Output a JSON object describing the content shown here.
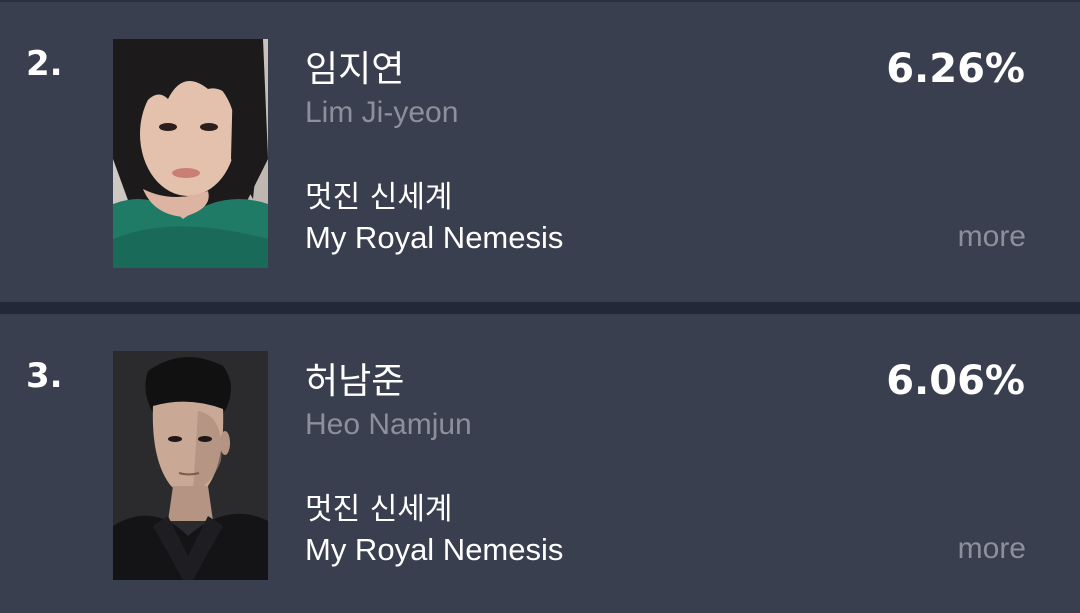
{
  "rankings": [
    {
      "rank": "2.",
      "name_ko": "임지연",
      "name_en": "Lim Ji-yeon",
      "show_ko": "멋진 신세계",
      "show_en": "My Royal Nemesis",
      "percent": "6.26%",
      "more": "more"
    },
    {
      "rank": "3.",
      "name_ko": "허남준",
      "name_en": "Heo Namjun",
      "show_ko": "멋진 신세계",
      "show_en": "My Royal Nemesis",
      "percent": "6.06%",
      "more": "more"
    }
  ],
  "colors": {
    "background": "#222734",
    "card": "#3a3f4f",
    "primary_text": "#ffffff",
    "secondary_text": "#8c909a"
  }
}
